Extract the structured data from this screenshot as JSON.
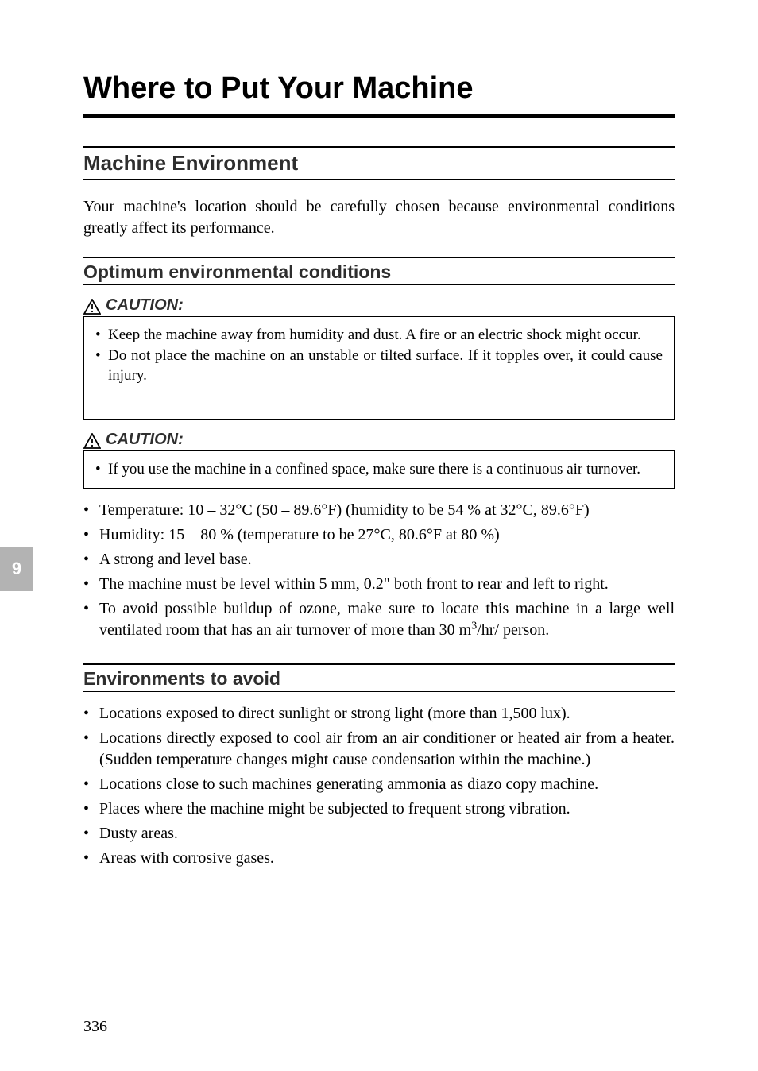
{
  "page": {
    "number": "336",
    "tab": "9",
    "title": "Where to Put Your Machine",
    "section": "Machine Environment",
    "intro": "Your machine's location should be carefully chosen because environmental conditions greatly affect its performance.",
    "env": {
      "heading": "Optimum environmental conditions",
      "caution_label": "CAUTION:",
      "caution1": [
        "Keep the machine away from humidity and dust. A fire or an electric shock might occur.",
        "Do not place the machine on an unstable or tilted surface. If it topples over, it could cause injury."
      ],
      "caution2": [
        "If you use the machine in a confined space, make sure there is a continuous air turnover."
      ],
      "bullets": {
        "b1_a": "Temperature: 10 – 32",
        "b1_b": "C (50 – 89.6",
        "b1_c": "F) (humidity to be 54 % at 32",
        "b1_d": "C, 89.6",
        "b1_e": "F)",
        "b2_a": "Humidity: 15 – 80 % (temperature to be 27",
        "b2_b": "C, 80.6",
        "b2_c": "F at 80 %)",
        "b3": "A strong and level base.",
        "b4": "The machine must be level within 5 mm, 0.2\" both front to rear and left to right.",
        "b5_a": "To avoid possible buildup of ozone, make sure to locate this machine in a large well ventilated room that has an air turnover of more than 30 m",
        "b5_sup": "3",
        "b5_b": "/hr/ person."
      }
    },
    "avoid": {
      "heading": "Environments to avoid",
      "bullets": [
        "Locations exposed to direct sunlight or strong light (more than 1,500 lux).",
        "Locations directly exposed to cool air from an air conditioner or heated air from a heater. (Sudden temperature changes might cause condensation within the machine.)",
        "Locations close to such machines generating ammonia as diazo copy machine.",
        "Places where the machine might be subjected to frequent strong vibration.",
        "Dusty areas.",
        "Areas with corrosive gases."
      ]
    }
  }
}
